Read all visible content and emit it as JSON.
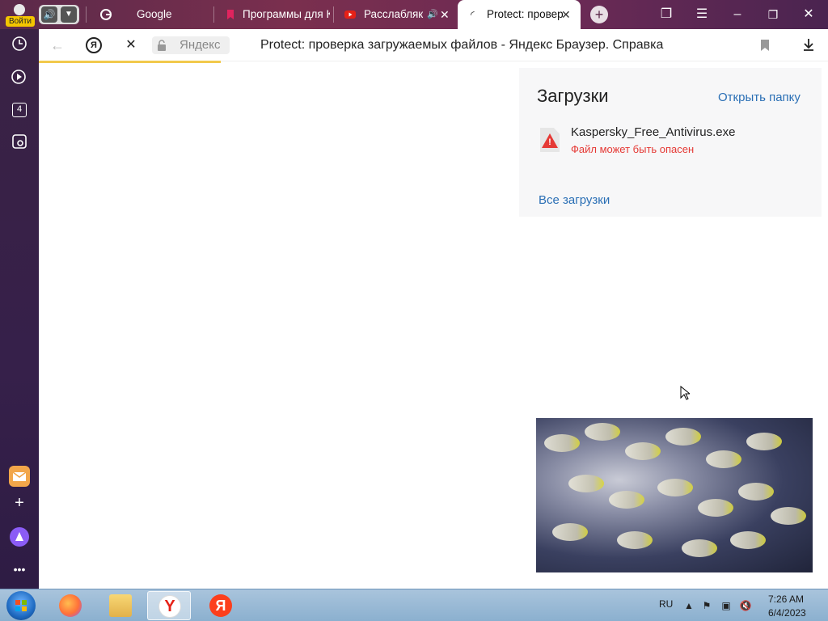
{
  "login": {
    "label": "Войти"
  },
  "tabs": [
    {
      "title": "Google"
    },
    {
      "title": "Программы для К"
    },
    {
      "title": "Расслабляк"
    },
    {
      "title": "Protect: провер"
    }
  ],
  "sidebar": {
    "badge_number": "4"
  },
  "omnibar": {
    "site_name": "Яндекс",
    "page_title": "Protect: проверка загружаемых файлов - Яндекс Браузер. Справка",
    "ya_label": "Я"
  },
  "downloads": {
    "title": "Загрузки",
    "open_folder": "Открыть папку",
    "file_name": "Kaspersky_Free_Antivirus.exe",
    "file_warning": "Файл может быть опасен",
    "all_downloads": "Все загрузки"
  },
  "taskbar": {
    "language": "RU",
    "time": "7:26 AM",
    "date": "6/4/2023"
  },
  "colors": {
    "accent_link": "#2a6fb5",
    "warning": "#e53935",
    "loadbar": "#f2c94c"
  }
}
